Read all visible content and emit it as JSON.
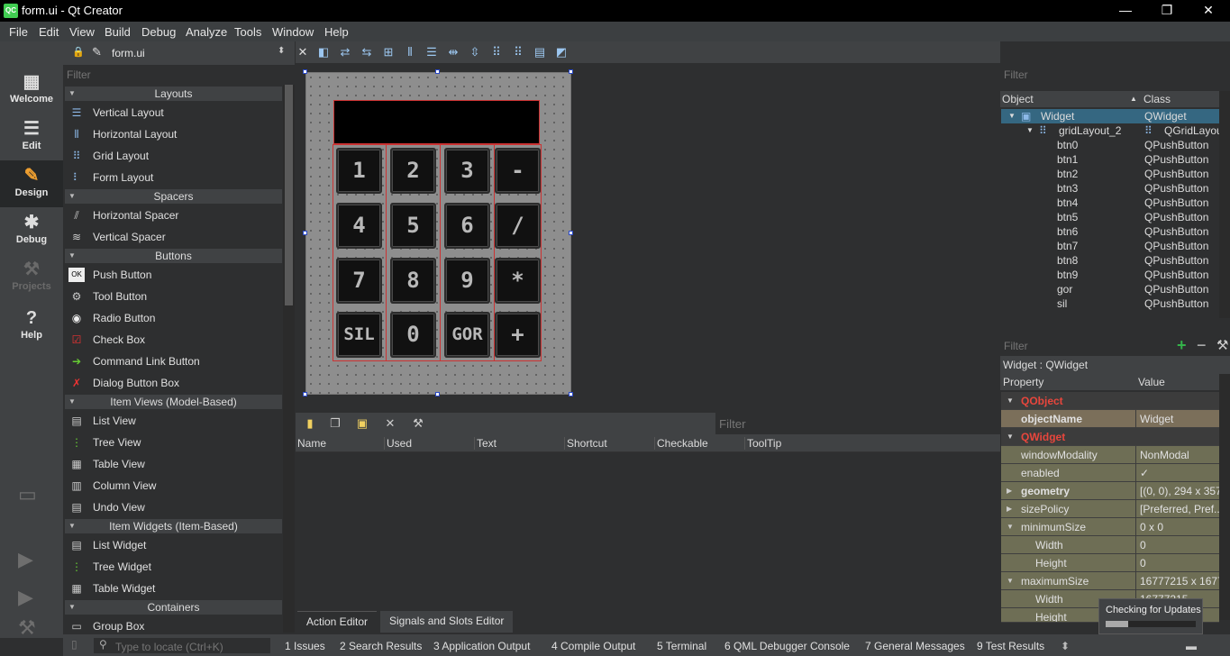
{
  "window": {
    "title": "form.ui - Qt Creator",
    "app_badge": "QC",
    "min": "—",
    "max": "❐",
    "close": "✕"
  },
  "menu": [
    "File",
    "Edit",
    "View",
    "Build",
    "Debug",
    "Analyze",
    "Tools",
    "Window",
    "Help"
  ],
  "modes": {
    "welcome": "Welcome",
    "edit": "Edit",
    "design": "Design",
    "debug": "Debug",
    "projects": "Projects",
    "help": "Help"
  },
  "editor": {
    "document": "form.ui"
  },
  "widgetbox": {
    "filter_placeholder": "Filter",
    "categories": {
      "layouts": "Layouts",
      "spacers": "Spacers",
      "buttons": "Buttons",
      "itemviews": "Item Views (Model-Based)",
      "itemwidgets": "Item Widgets (Item-Based)",
      "containers": "Containers"
    },
    "items": [
      "Vertical Layout",
      "Horizontal Layout",
      "Grid Layout",
      "Form Layout",
      "Horizontal Spacer",
      "Vertical Spacer",
      "Push Button",
      "Tool Button",
      "Radio Button",
      "Check Box",
      "Command Link Button",
      "Dialog Button Box",
      "List View",
      "Tree View",
      "Table View",
      "Column View",
      "Undo View",
      "List Widget",
      "Tree Widget",
      "Table Widget",
      "Group Box"
    ]
  },
  "calculator": {
    "buttons": [
      "1",
      "2",
      "3",
      "-",
      "4",
      "5",
      "6",
      "/",
      "7",
      "8",
      "9",
      "*",
      "SIL",
      "0",
      "GOR",
      "+"
    ]
  },
  "action_editor": {
    "filter_placeholder": "Filter",
    "columns": [
      "Name",
      "Used",
      "Text",
      "Shortcut",
      "Checkable",
      "ToolTip"
    ],
    "tabs": [
      "Action Editor",
      "Signals and Slots Editor"
    ]
  },
  "object_inspector": {
    "filter_placeholder": "Filter",
    "headers": [
      "Object",
      "Class"
    ],
    "rows": [
      {
        "object": "Widget",
        "class": "QWidget"
      },
      {
        "object": "gridLayout_2",
        "class": "QGridLayout"
      },
      {
        "object": "btn0",
        "class": "QPushButton"
      },
      {
        "object": "btn1",
        "class": "QPushButton"
      },
      {
        "object": "btn2",
        "class": "QPushButton"
      },
      {
        "object": "btn3",
        "class": "QPushButton"
      },
      {
        "object": "btn4",
        "class": "QPushButton"
      },
      {
        "object": "btn5",
        "class": "QPushButton"
      },
      {
        "object": "btn6",
        "class": "QPushButton"
      },
      {
        "object": "btn7",
        "class": "QPushButton"
      },
      {
        "object": "btn8",
        "class": "QPushButton"
      },
      {
        "object": "btn9",
        "class": "QPushButton"
      },
      {
        "object": "gor",
        "class": "QPushButton"
      },
      {
        "object": "sil",
        "class": "QPushButton"
      }
    ]
  },
  "property_editor": {
    "filter_placeholder": "Filter",
    "context": "Widget : QWidget",
    "headers": [
      "Property",
      "Value"
    ],
    "rows": [
      {
        "key": "QObject",
        "value": ""
      },
      {
        "key": "objectName",
        "value": "Widget"
      },
      {
        "key": "QWidget",
        "value": ""
      },
      {
        "key": "windowModality",
        "value": "NonModal"
      },
      {
        "key": "enabled",
        "value": "✓"
      },
      {
        "key": "geometry",
        "value": "[(0, 0), 294 x 357]"
      },
      {
        "key": "sizePolicy",
        "value": "[Preferred, Pref..."
      },
      {
        "key": "minimumSize",
        "value": "0 x 0"
      },
      {
        "key": "Width",
        "value": "0"
      },
      {
        "key": "Height",
        "value": "0"
      },
      {
        "key": "maximumSize",
        "value": "16777215 x 1677..."
      },
      {
        "key": "Width",
        "value": "16777215"
      },
      {
        "key": "Height",
        "value": ""
      }
    ]
  },
  "update_toast": {
    "text": "Checking for Updates",
    "progress": 0.25
  },
  "statusbar": {
    "locator_placeholder": "Type to locate (Ctrl+K)",
    "panes": [
      "1  Issues",
      "2  Search Results",
      "3  Application Output",
      "4  Compile Output",
      "5  Terminal",
      "6  QML Debugger Console",
      "7  General Messages",
      "9  Test Results"
    ]
  }
}
